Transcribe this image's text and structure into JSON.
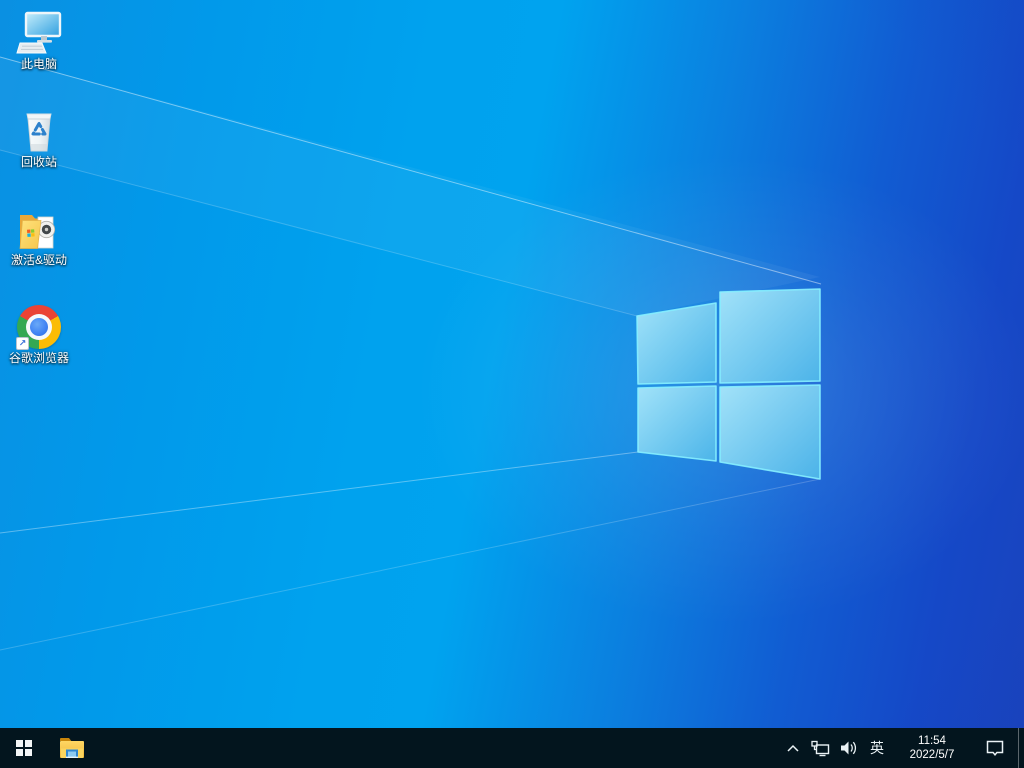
{
  "colors": {
    "wallpaper_left": "#00a2ee",
    "wallpaper_right": "#1a43bd",
    "logo_pane_light": "#a9e7fa",
    "logo_pane_dark": "#4fb9ea",
    "logo_edge": "#86efff",
    "taskbar_bg": "#03151e",
    "chrome_red": "#ea4335",
    "chrome_yellow": "#fbbc05",
    "chrome_green": "#34a853",
    "chrome_blue": "#4285f4",
    "folder_yellow": "#f7cd52"
  },
  "desktop": {
    "icons": [
      {
        "id": "this-pc",
        "label": "此电脑"
      },
      {
        "id": "recycle-bin",
        "label": "回收站"
      },
      {
        "id": "activation-drivers",
        "label": "激活&驱动"
      },
      {
        "id": "google-chrome",
        "label": "谷歌浏览器"
      }
    ]
  },
  "taskbar": {
    "start_icon": "windows-logo-icon",
    "pinned_icons": [
      "file-explorer-icon"
    ],
    "tray": {
      "hidden_icons": "chevron-up-icon",
      "network_icon": "ethernet-network-icon",
      "volume_icon": "speaker-volume-icon",
      "ime_indicator": "英",
      "clock": {
        "time": "11:54",
        "date": "2022/5/7"
      },
      "action_center_icon": "notification-bubble-icon"
    }
  }
}
